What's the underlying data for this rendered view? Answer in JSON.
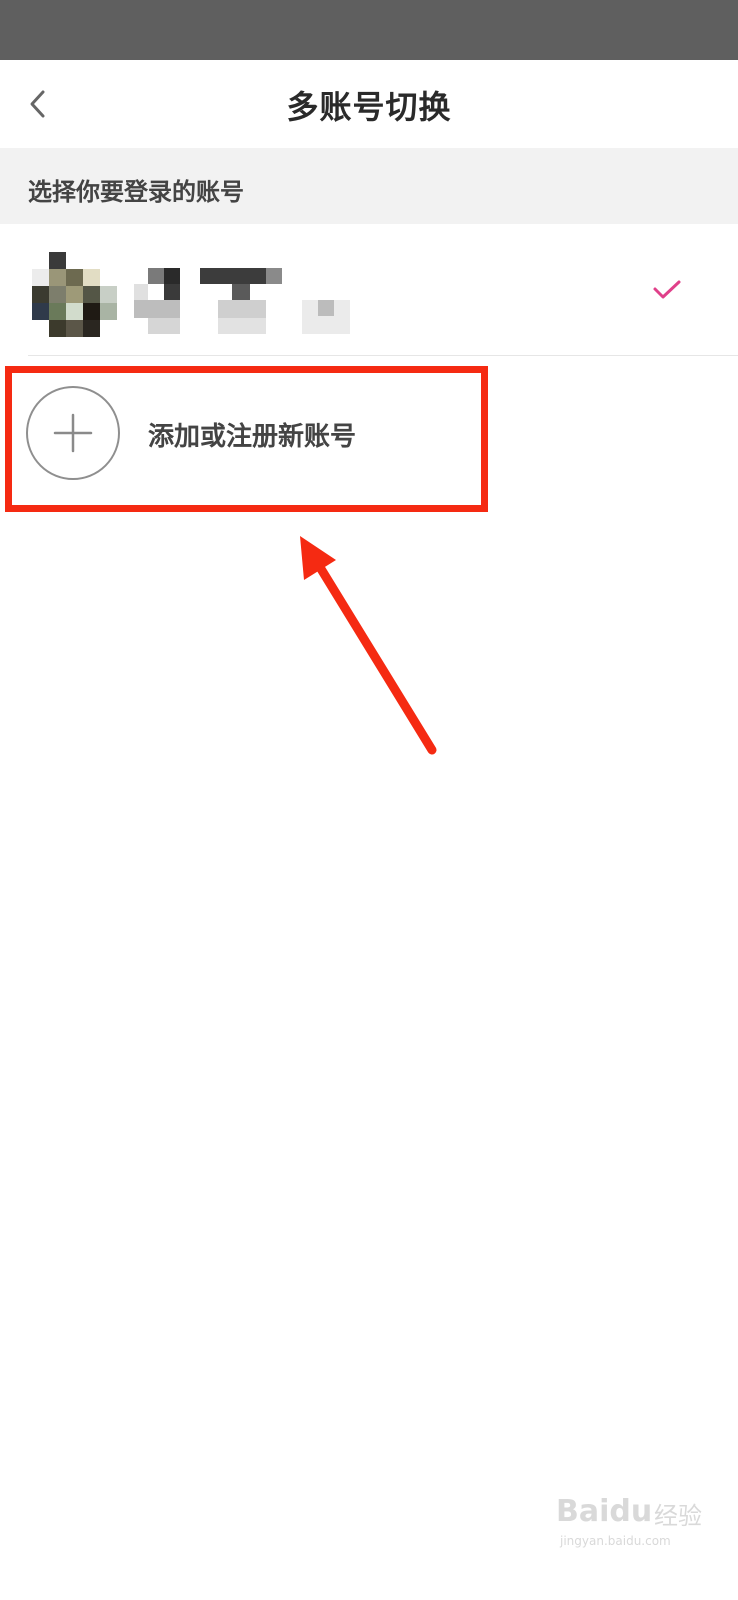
{
  "header": {
    "title": "多账号切换",
    "back_icon": "chevron-left-icon"
  },
  "section": {
    "label": "选择你要登录的账号"
  },
  "account": {
    "selected": true,
    "check_icon": "checkmark-icon",
    "check_color": "#e0408a"
  },
  "add_account": {
    "label": "添加或注册新账号",
    "icon": "plus-icon"
  },
  "annotation": {
    "color": "#f52a12"
  },
  "watermark": {
    "brand": "Baidu",
    "suffix": "经验",
    "url": "jingyan.baidu.com"
  }
}
